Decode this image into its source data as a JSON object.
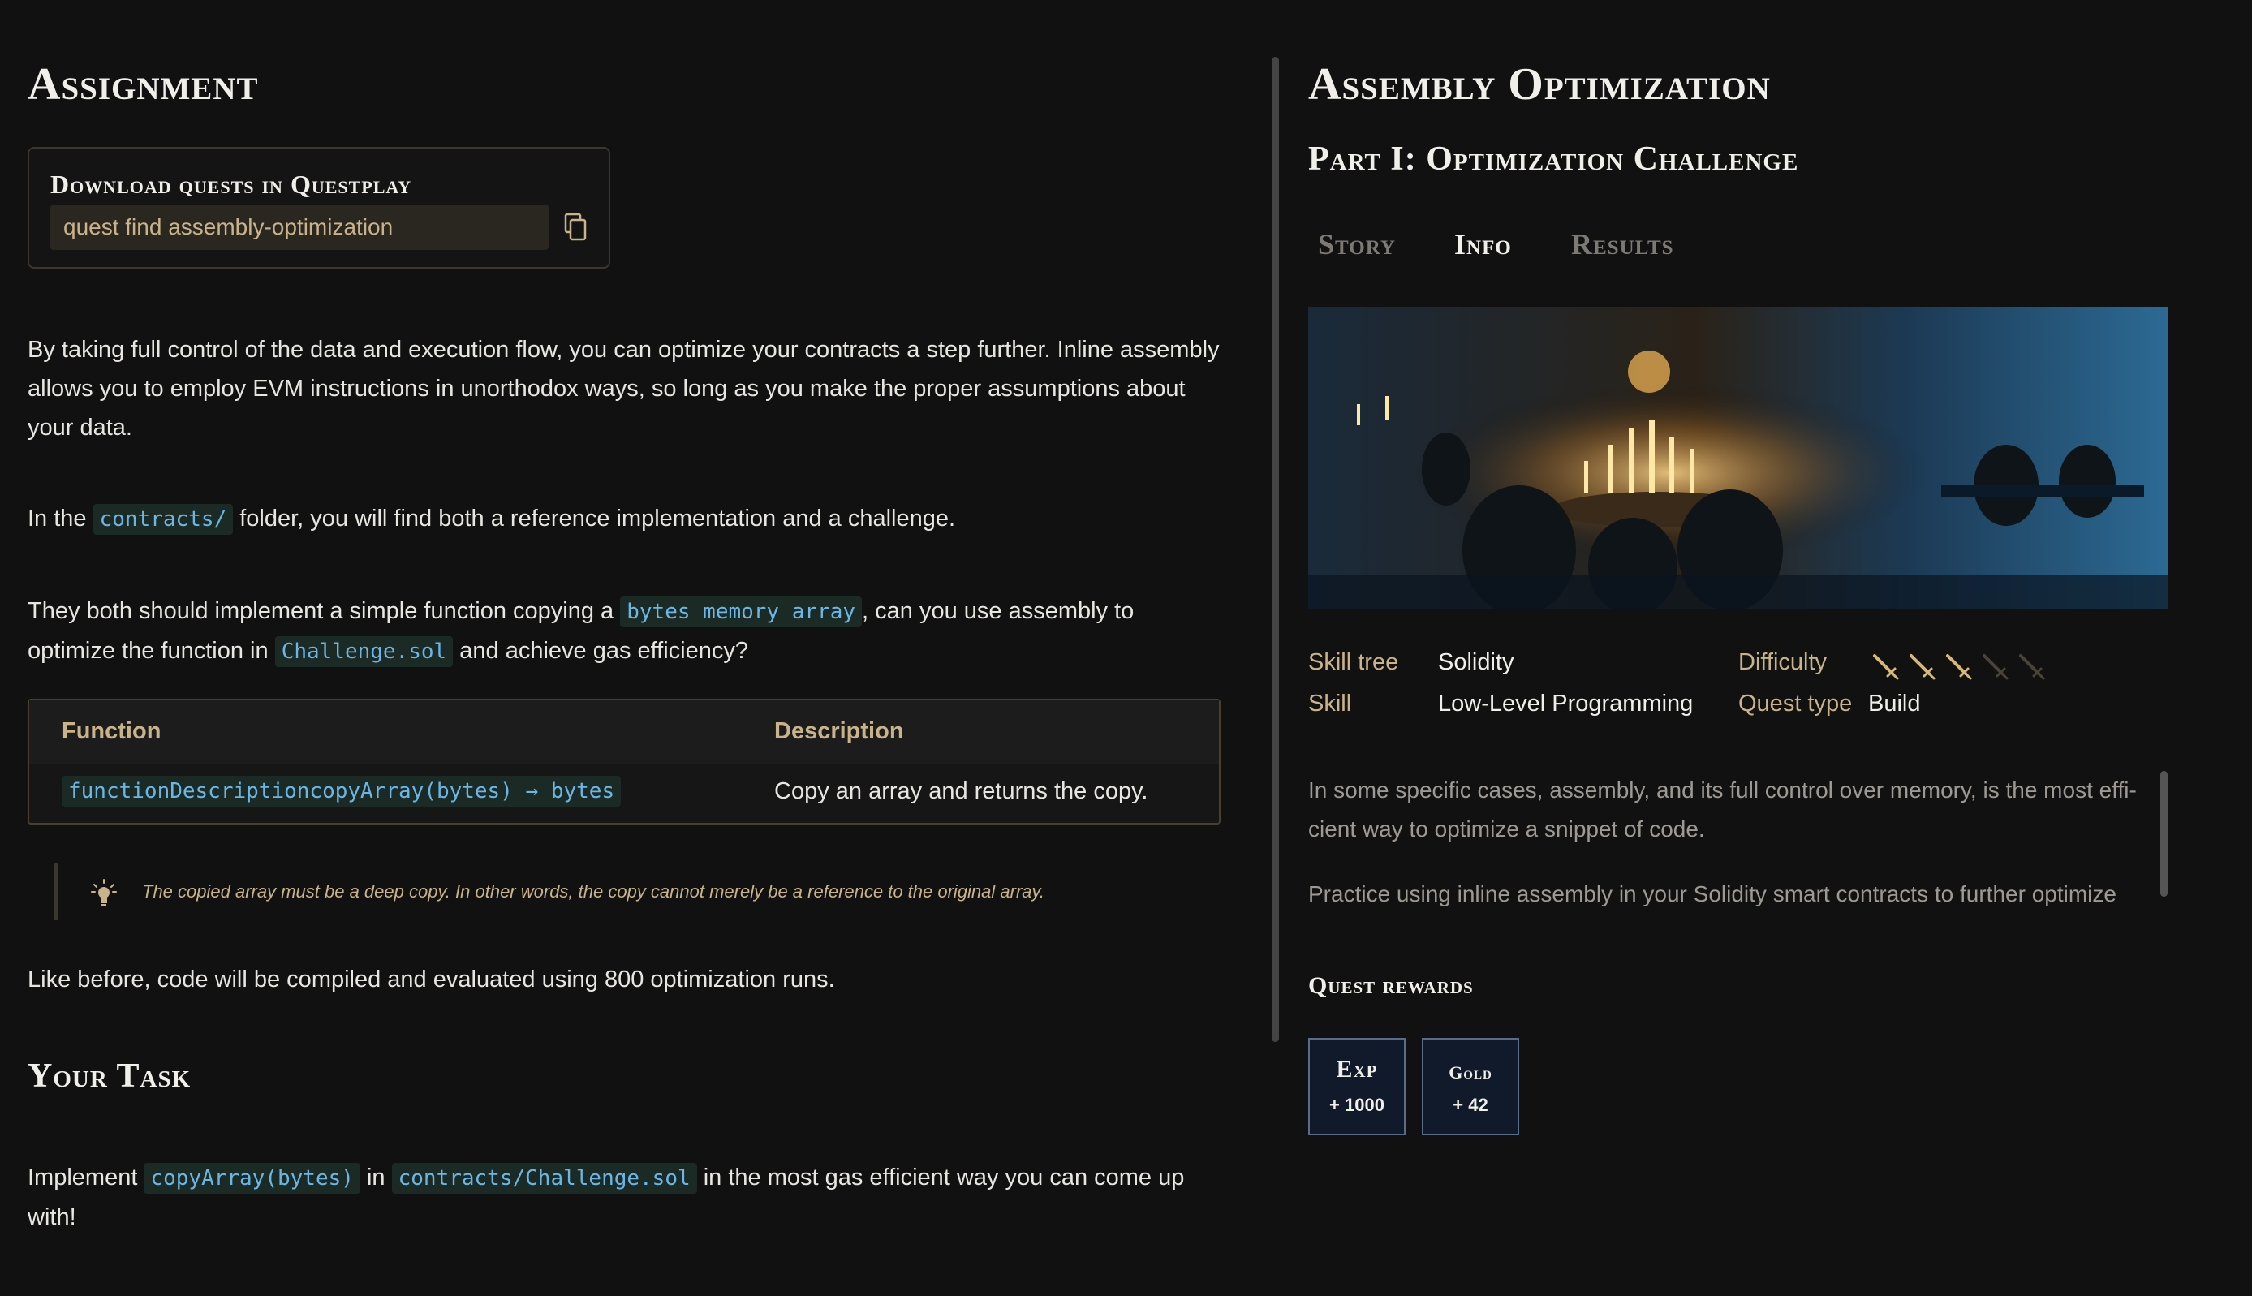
{
  "left": {
    "title": "Assignment",
    "download": {
      "title": "Download quests in Questplay",
      "command": "quest find assembly-optimization"
    },
    "intro": "By taking full control of the data and execution flow, you can optimize your contracts a step further. Inline assembly allows you to employ EVM instructions in unorthodox ways, so long as you make the proper assumptions about your data.",
    "folder_para": {
      "pre": "In the",
      "code": "contracts/",
      "post": "folder, you will find both a reference implementation and a challenge."
    },
    "task_para": {
      "pre": "They both should implement a simple function copying a",
      "code1": "bytes memory array",
      "mid": ", can you use assembly to optimize the function in",
      "code2": "Challenge.sol",
      "post": "and achieve gas efficiency?"
    },
    "table": {
      "headers": [
        "Function",
        "Description"
      ],
      "rows": [
        {
          "signature": "functionDescriptioncopyArray(bytes) → bytes",
          "description": "Copy an array and returns the copy."
        }
      ]
    },
    "tip": "The copied array must be a deep copy. In other words, the copy cannot merely be a reference to the original array.",
    "runs_para": "Like before, code will be compiled and evaluated using 800 optimization runs.",
    "your_task": {
      "title": "Your Task",
      "pre": "Implement",
      "code1": "copyArray(bytes)",
      "mid": "in",
      "code2": "contracts/Challenge.sol",
      "post": "in the most gas efficient way you can come up with!"
    }
  },
  "right": {
    "title": "Assembly Optimization",
    "part": "Part I: Optimization Challenge",
    "tabs": [
      "Story",
      "Info",
      "Results"
    ],
    "active_tab": "Info",
    "meta": {
      "skill_tree_label": "Skill tree",
      "skill_tree": "Solidity",
      "skill_label": "Skill",
      "skill": "Low-Level Programming",
      "difficulty_label": "Difficulty",
      "difficulty": 3,
      "difficulty_max": 5,
      "quest_type_label": "Quest type",
      "quest_type": "Build"
    },
    "description": [
      "In some specific cases, assembly, and its full control over memory, is the most effi-cient way to optimize a snippet of code.",
      "Practice using inline assembly in your Solidity smart contracts to further optimize"
    ],
    "rewards_title": "Quest rewards",
    "rewards": [
      {
        "label": "Exp",
        "value": "+ 1000"
      },
      {
        "label": "Gold",
        "value": "+ 42"
      }
    ]
  },
  "colors": {
    "background": "#111111",
    "accent_gold": "#c9b38a",
    "code_text": "#6cb6e6",
    "code_bg": "#1b2a24",
    "reward_bg": "#101a2b"
  },
  "icons": [
    "copy-icon",
    "lightbulb-icon",
    "sword-icon"
  ]
}
